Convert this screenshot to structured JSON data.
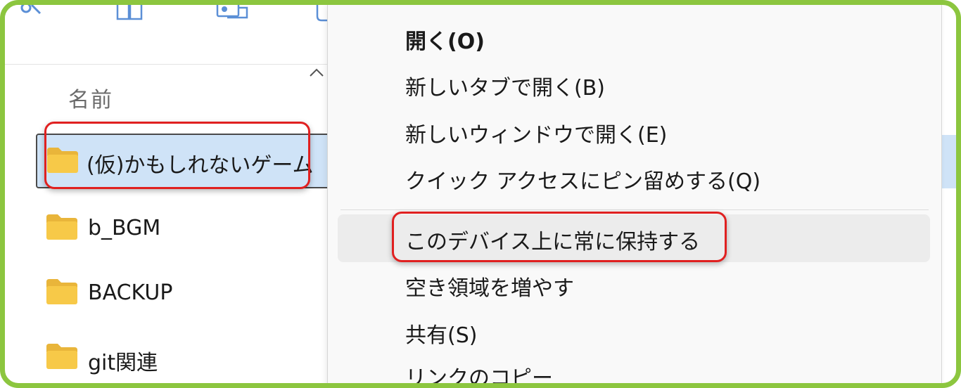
{
  "explorer": {
    "column_header": "名前",
    "files": [
      {
        "name": "(仮)かもしれないゲーム",
        "type": "folder",
        "selected": true
      },
      {
        "name": "b_BGM",
        "type": "folder",
        "selected": false
      },
      {
        "name": "BACKUP",
        "type": "folder",
        "selected": false
      },
      {
        "name": "git関連",
        "type": "folder",
        "selected": false
      }
    ]
  },
  "context_menu": {
    "items": [
      {
        "label": "開く(O)"
      },
      {
        "label": "新しいタブで開く(B)"
      },
      {
        "label": "新しいウィンドウで開く(E)"
      },
      {
        "label": "クイック アクセスにピン留めする(Q)"
      },
      {
        "label": "このデバイス上に常に保持する"
      },
      {
        "label": "空き領域を増やす"
      },
      {
        "label": "共有(S)"
      },
      {
        "label": "リンクのコピー"
      }
    ]
  },
  "colors": {
    "frame_border": "#8cc63f",
    "highlight_box": "#e02020",
    "selection_bg": "#cfe3f7",
    "folder_body": "#f7c948",
    "folder_tab": "#e9b53a"
  },
  "icons": [
    "toolbar-cut-icon",
    "toolbar-copy-icon",
    "toolbar-paste-icon",
    "toolbar-rename-icon",
    "sort-ascending-icon",
    "folder-icon"
  ]
}
